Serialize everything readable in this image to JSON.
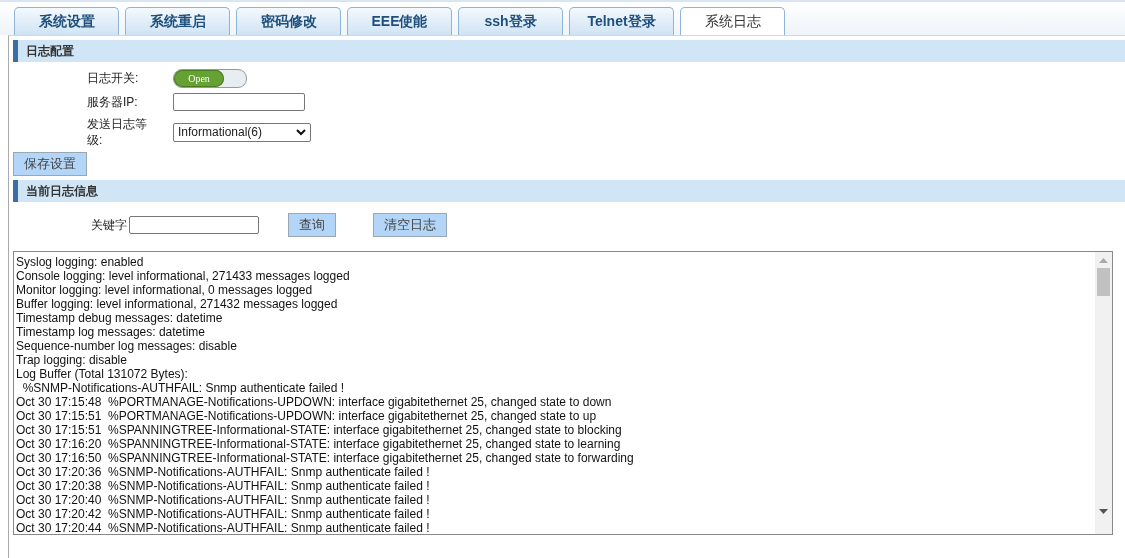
{
  "tabs": [
    {
      "label": "系统设置",
      "selected": false
    },
    {
      "label": "系统重启",
      "selected": false
    },
    {
      "label": "密码修改",
      "selected": false
    },
    {
      "label": "EEE使能",
      "selected": false
    },
    {
      "label": "ssh登录",
      "selected": false
    },
    {
      "label": "Telnet登录",
      "selected": false
    },
    {
      "label": "系统日志",
      "selected": true
    }
  ],
  "log_config": {
    "title": "日志配置",
    "switch": {
      "label": "日志开关:",
      "text": "Open",
      "on": true
    },
    "server_ip": {
      "label": "服务器IP:"
    },
    "level_select": {
      "label": "发送日志等级:",
      "value": "Informational(6)"
    },
    "save_button": "保存设置"
  },
  "log_info": {
    "title": "当前日志信息",
    "keyword": {
      "label": "关键字"
    },
    "query_button": "查询",
    "clear_button": "清空日志",
    "lines": [
      "Syslog logging: enabled",
      "Console logging: level informational, 271433 messages logged",
      "Monitor logging: level informational, 0 messages logged",
      "Buffer logging: level informational, 271432 messages logged",
      "Timestamp debug messages: datetime",
      "Timestamp log messages: datetime",
      "Sequence-number log messages: disable",
      "Trap logging: disable",
      "Log Buffer (Total 131072 Bytes):",
      "  %SNMP-Notifications-AUTHFAIL: Snmp authenticate failed !",
      "Oct 30 17:15:48  %PORTMANAGE-Notifications-UPDOWN: interface gigabitethernet 25, changed state to down",
      "Oct 30 17:15:51  %PORTMANAGE-Notifications-UPDOWN: interface gigabitethernet 25, changed state to up",
      "Oct 30 17:15:51  %SPANNINGTREE-Informational-STATE: interface gigabitethernet 25, changed state to blocking",
      "Oct 30 17:16:20  %SPANNINGTREE-Informational-STATE: interface gigabitethernet 25, changed state to learning",
      "Oct 30 17:16:50  %SPANNINGTREE-Informational-STATE: interface gigabitethernet 25, changed state to forwarding",
      "Oct 30 17:20:36  %SNMP-Notifications-AUTHFAIL: Snmp authenticate failed !",
      "Oct 30 17:20:38  %SNMP-Notifications-AUTHFAIL: Snmp authenticate failed !",
      "Oct 30 17:20:40  %SNMP-Notifications-AUTHFAIL: Snmp authenticate failed !",
      "Oct 30 17:20:42  %SNMP-Notifications-AUTHFAIL: Snmp authenticate failed !",
      "Oct 30 17:20:44  %SNMP-Notifications-AUTHFAIL: Snmp authenticate failed !"
    ]
  }
}
